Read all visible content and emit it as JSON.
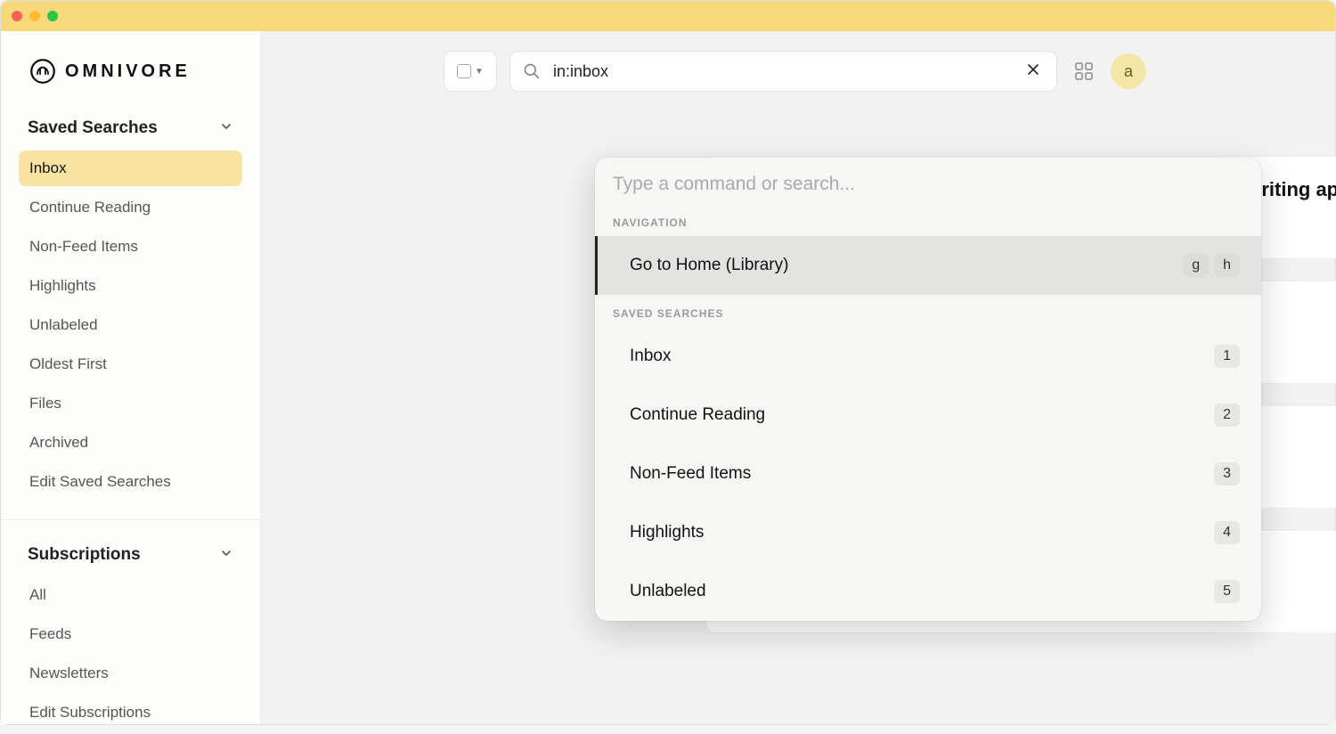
{
  "app": {
    "name": "OMNIVORE"
  },
  "sidebar": {
    "saved_searches": {
      "title": "Saved Searches",
      "items": [
        {
          "label": "Inbox",
          "active": true
        },
        {
          "label": "Continue Reading"
        },
        {
          "label": "Non-Feed Items"
        },
        {
          "label": "Highlights"
        },
        {
          "label": "Unlabeled"
        },
        {
          "label": "Oldest First"
        },
        {
          "label": "Files"
        },
        {
          "label": "Archived"
        },
        {
          "label": "Edit Saved Searches"
        }
      ]
    },
    "subscriptions": {
      "title": "Subscriptions",
      "items": [
        {
          "label": "All"
        },
        {
          "label": "Feeds"
        },
        {
          "label": "Newsletters"
        },
        {
          "label": "Edit Subscriptions"
        }
      ]
    }
  },
  "search": {
    "value": "in:inbox"
  },
  "avatar": {
    "initial": "a"
  },
  "article_hint": {
    "title_fragment": "riting app for"
  },
  "palette": {
    "placeholder": "Type a command or search...",
    "groups": [
      {
        "label": "NAVIGATION",
        "items": [
          {
            "label": "Go to Home (Library)",
            "keys": [
              "g",
              "h"
            ],
            "highlight": true
          }
        ]
      },
      {
        "label": "SAVED SEARCHES",
        "items": [
          {
            "label": "Inbox",
            "keys": [
              "1"
            ]
          },
          {
            "label": "Continue Reading",
            "keys": [
              "2"
            ]
          },
          {
            "label": "Non-Feed Items",
            "keys": [
              "3"
            ]
          },
          {
            "label": "Highlights",
            "keys": [
              "4"
            ]
          },
          {
            "label": "Unlabeled",
            "keys": [
              "5"
            ]
          }
        ]
      }
    ]
  }
}
